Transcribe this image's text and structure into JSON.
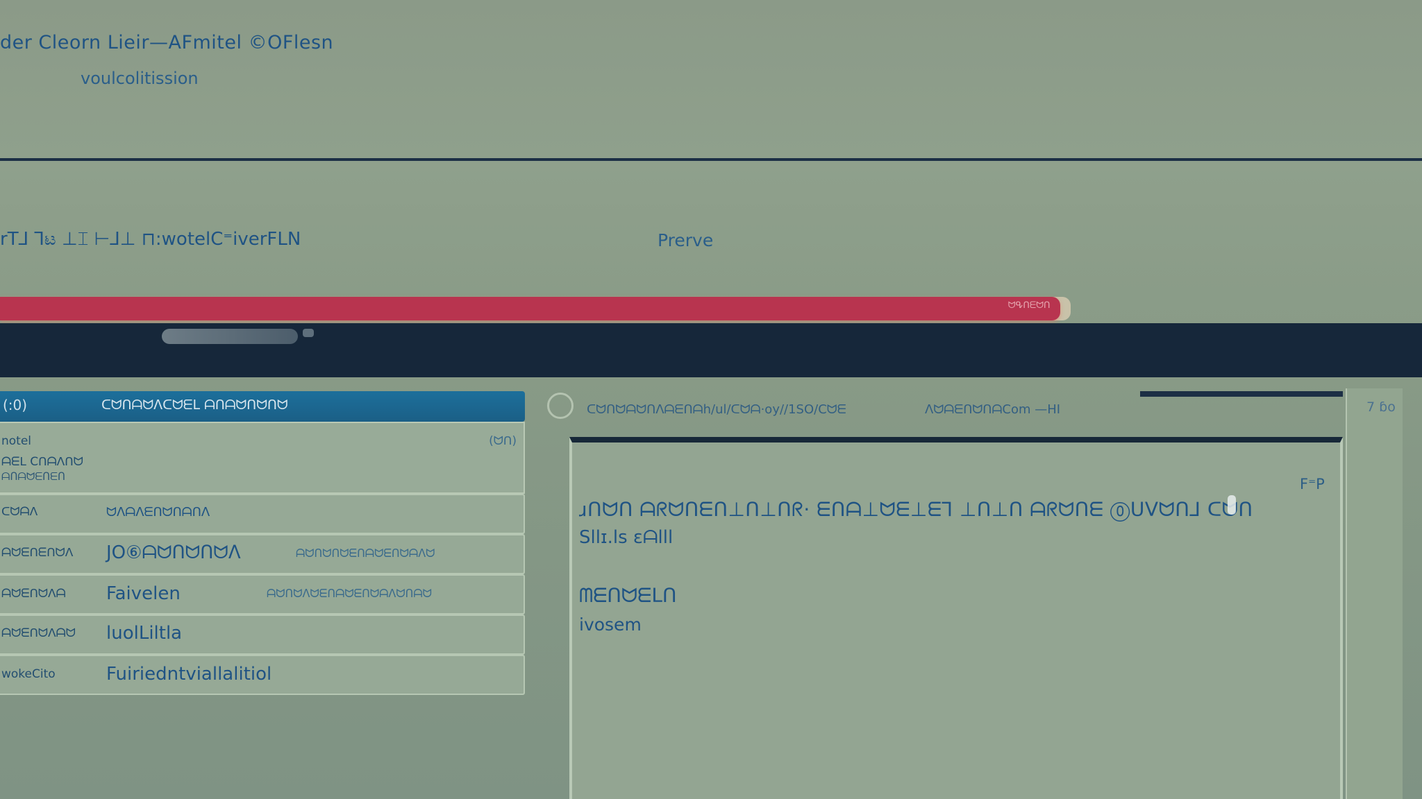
{
  "window": {
    "title": "der Cleorn Lieir—AFmitel ©OFlesn",
    "subtitle": "voulcolitission"
  },
  "subbar": {
    "path_text": "rT⅃ ⅂ಟ ⊥⌶ ⊢⅃⊥ ⊓:wotelC⁼iverFLN",
    "preview_label": "Prerve"
  },
  "progress": {
    "value": 0.99,
    "label": "ᗢᕴᑎᗴᗢᑎ"
  },
  "list": {
    "header_count": "(:0)",
    "header_title": "ᑕᗢᑎᗩᗢᐱᑕᗢᗴᒪ ᗩᑎᗩᗢᑎᗢᑎᗢ",
    "detail": {
      "line1": "notel",
      "line2": "ᗩᗴᒪ Cᑎᗩᐱᑎᗢ",
      "line3": "ᗩᑎᗩᗢᗴᑎᗴᑎ",
      "badge": "(ᗢᑎ)"
    },
    "rows": [
      {
        "key": "ᑕᗢᗩᐱ",
        "value": "ᗢᐱᗩᐱᗴᑎᗢᑎᗩᑎᐱ",
        "extra": ""
      },
      {
        "key": "ᗩᗢᗴᑎᗴᑎᗢᐱ",
        "value": "JO⑥ᗩᗢᑎᗢᑎᗢᐱ",
        "extra": "ᗩᗢᑎᗢᑎᗢᗴᑎᗩᗢᗴᑎᗢᗩᐱᗢ"
      },
      {
        "key": "ᗩᗢᗴᑎᗢᐱᗩ",
        "value": "Faivelen",
        "extra": "ᗩᗢᑎᗢᐱᗢᗴᑎᗩᗢᗴᑎᗢᗩᐱᗢᑎᗩᗢ"
      },
      {
        "key": "ᗩᗢᗴᑎᗢᐱᗩᗢ",
        "value": "luolLiltla",
        "extra": ""
      },
      {
        "key": "wokeCito",
        "value": "Fuiriedntviallalitiol",
        "extra": ""
      }
    ]
  },
  "document": {
    "url": "ᑕᗢᑎᗢᗩᗢᑎᐱᗩᗴᑎᗩh/ul/ᑕᗢᗩ·oy//1SO/Cᗢᗴ",
    "url_tail": "ᐱᗢᗩᗴᑎᗢᑎᗩCom —HI",
    "page_count": "7 ɓo",
    "corner_label": "F⁼P",
    "line1": "ɹᑎᗢᑎ ᗩᖇᗢᑎᗴᑎ⊥ᑎ⊥ᑎᖇ· ᗴᑎᗩ⊥ᗢᗴ⊥ᗴ⅂ ⊥ᑎ⊥ᑎ ᗩᖇᗢᑎᗴ ⓪ᑌᐯᗢᑎ⅃ ᑕᗢᑎ",
    "line2": "Sllɪ.ls ɛᗩlll",
    "line3": "ᗰᗴᑎᗢᗴᒪᑎ",
    "line4": "ivosem"
  },
  "colors": {
    "progress_fill": "#b8344f",
    "list_header": "#1c6f9b",
    "dark_band": "#16273a",
    "text_blue": "#1f5384"
  }
}
